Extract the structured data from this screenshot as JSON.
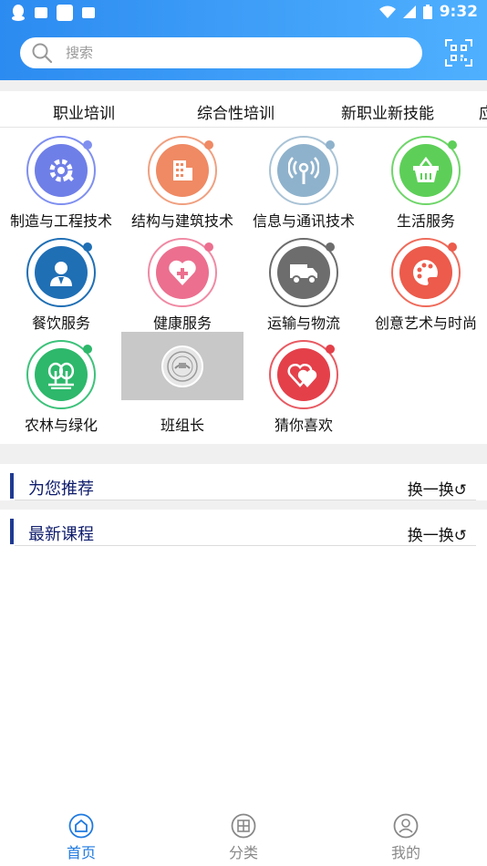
{
  "status_bar": {
    "time": "9:32"
  },
  "search": {
    "placeholder": "搜索"
  },
  "tabs": [
    "职业培训",
    "综合性培训",
    "新职业新技能",
    "应"
  ],
  "categories": [
    {
      "label": "制造与工程技术",
      "color": "#6f7fe8",
      "ring": "#7f8ff0",
      "dot": "#7f8ff0",
      "icon": "gear-wrench-icon"
    },
    {
      "label": "结构与建筑技术",
      "color": "#ef8a64",
      "ring": "#f0a080",
      "dot": "#ef8a64",
      "icon": "building-icon"
    },
    {
      "label": "信息与通讯技术",
      "color": "#8fb2cc",
      "ring": "#a9c3d6",
      "dot": "#8fb2cc",
      "icon": "antenna-icon"
    },
    {
      "label": "生活服务",
      "color": "#5dcf58",
      "ring": "#6fd66a",
      "dot": "#5dcf58",
      "icon": "basket-icon"
    },
    {
      "label": "餐饮服务",
      "color": "#1f6fb5",
      "ring": "#1f6fb5",
      "dot": "#1f6fb5",
      "icon": "chef-icon"
    },
    {
      "label": "健康服务",
      "color": "#ec6f8f",
      "ring": "#f08aa4",
      "dot": "#ec6f8f",
      "icon": "heart-plus-icon"
    },
    {
      "label": "运输与物流",
      "color": "#6d6d6d",
      "ring": "#6d6d6d",
      "dot": "#6d6d6d",
      "icon": "truck-icon"
    },
    {
      "label": "创意艺术与时尚",
      "color": "#ec5b4b",
      "ring": "#ef6b5b",
      "dot": "#ec5b4b",
      "icon": "palette-icon"
    },
    {
      "label": "农林与绿化",
      "color": "#2db86b",
      "ring": "#3cc27a",
      "dot": "#2db86b",
      "icon": "trees-icon"
    },
    {
      "label": "班组长",
      "color": "#c8c8c8",
      "ring": "#c8c8c8",
      "dot": "#c8c8c8",
      "icon": "emblem-icon"
    },
    {
      "label": "猜你喜欢",
      "color": "#e4404a",
      "ring": "#e85a62",
      "dot": "#e4404a",
      "icon": "hearts-icon"
    }
  ],
  "sections": [
    {
      "title": "为您推荐",
      "more": "换一换↺"
    },
    {
      "title": "最新课程",
      "more": "换一换↺"
    }
  ],
  "nav": [
    {
      "label": "首页",
      "active": true,
      "icon": "home-icon"
    },
    {
      "label": "分类",
      "active": false,
      "icon": "category-icon"
    },
    {
      "label": "我的",
      "active": false,
      "icon": "profile-icon"
    }
  ],
  "colors": {
    "accent": "#2c8bf0",
    "nav_active": "#1f7ae0",
    "nav_inactive": "#888888"
  }
}
